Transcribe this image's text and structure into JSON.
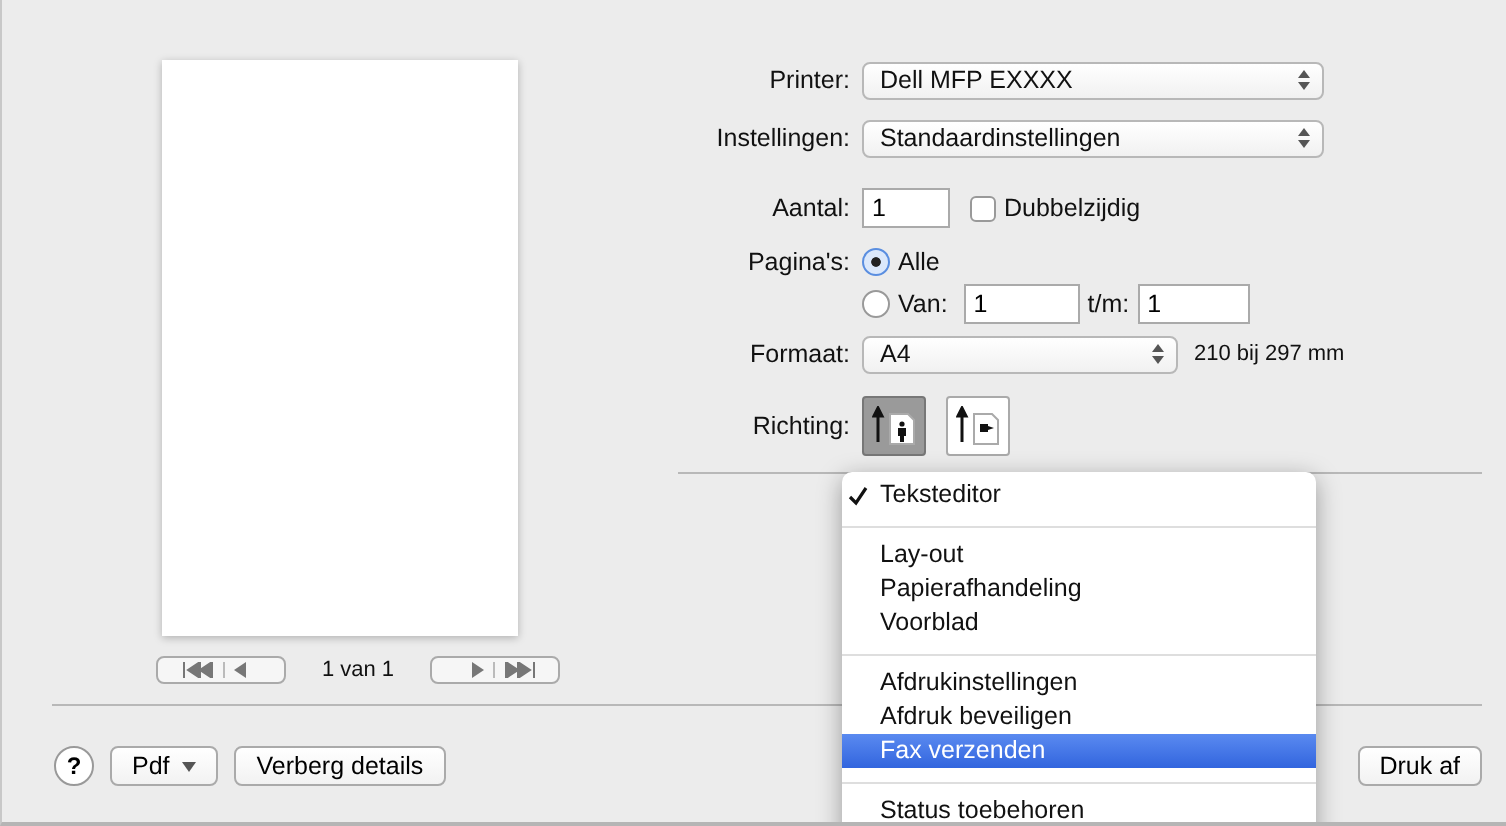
{
  "preview": {
    "page_count": "1 van 1"
  },
  "form": {
    "printer": {
      "label": "Printer:",
      "value": "Dell MFP EXXXX"
    },
    "settings": {
      "label": "Instellingen:",
      "value": "Standaardinstellingen"
    },
    "copies": {
      "label": "Aantal:",
      "value": "1"
    },
    "duplex": {
      "label": "Dubbelzijdig",
      "checked": false
    },
    "pages": {
      "label": "Pagina's:",
      "options": [
        {
          "label": "Alle",
          "selected": true
        },
        {
          "label": "Van:",
          "selected": false
        }
      ],
      "from": "1",
      "to_label": "t/m:",
      "to": "1"
    },
    "format": {
      "label": "Formaat:",
      "value": "A4",
      "size": "210 bij 297 mm"
    },
    "orientation": {
      "label": "Richting:",
      "options": [
        {
          "kind": "portrait",
          "selected": true
        },
        {
          "kind": "landscape",
          "selected": false
        }
      ]
    }
  },
  "menu": {
    "groups": [
      [
        {
          "label": "Teksteditor",
          "checked": true,
          "selected": false
        }
      ],
      [
        {
          "label": "Lay-out",
          "checked": false,
          "selected": false
        },
        {
          "label": "Papierafhandeling",
          "checked": false,
          "selected": false
        },
        {
          "label": "Voorblad",
          "checked": false,
          "selected": false
        }
      ],
      [
        {
          "label": "Afdrukinstellingen",
          "checked": false,
          "selected": false
        },
        {
          "label": "Afdruk beveiligen",
          "checked": false,
          "selected": false
        },
        {
          "label": "Fax verzenden",
          "checked": false,
          "selected": true
        }
      ],
      [
        {
          "label": "Status toebehoren",
          "checked": false,
          "selected": false
        }
      ]
    ]
  },
  "bottom": {
    "help": "?",
    "pdf": "Pdf",
    "details": "Verberg details",
    "print": "Druk af"
  }
}
